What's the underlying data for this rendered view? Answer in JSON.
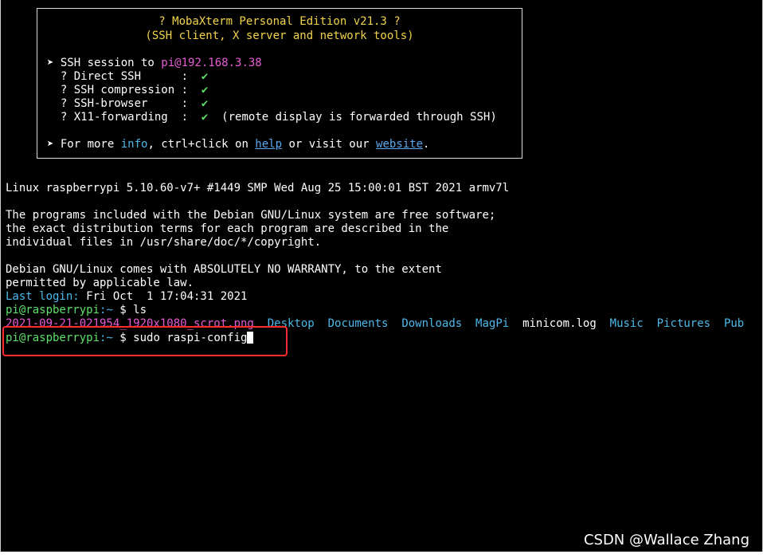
{
  "banner": {
    "title": "? MobaXterm Personal Edition v21.3 ?",
    "subtitle": "(SSH client, X server and network tools)",
    "session_prefix": "➤ SSH session to ",
    "session_target": "pi@192.168.3.38",
    "features": [
      {
        "label": "  ? Direct SSH      :  ",
        "check": "✔",
        "note": ""
      },
      {
        "label": "  ? SSH compression :  ",
        "check": "✔",
        "note": ""
      },
      {
        "label": "  ? SSH-browser     :  ",
        "check": "✔",
        "note": ""
      },
      {
        "label": "  ? X11-forwarding  :  ",
        "check": "✔",
        "note": "  (remote display is forwarded through SSH)"
      }
    ],
    "more_prefix": "➤ For more ",
    "more_info": "info",
    "more_mid": ", ctrl+click on ",
    "more_help": "help",
    "more_mid2": " or visit our ",
    "more_website": "website",
    "more_end": "."
  },
  "terminal": {
    "uname": "Linux raspberrypi 5.10.60-v7+ #1449 SMP Wed Aug 25 15:00:01 BST 2021 armv7l",
    "motd": [
      "The programs included with the Debian GNU/Linux system are free software;",
      "the exact distribution terms for each program are described in the",
      "individual files in /usr/share/doc/*/copyright."
    ],
    "warranty": [
      "Debian GNU/Linux comes with ABSOLUTELY NO WARRANTY, to the extent",
      "permitted by applicable law."
    ],
    "last_login_label": "Last login:",
    "last_login_value": " Fri Oct  1 17:04:31 2021",
    "prompt_user": "pi@raspberrypi",
    "prompt_sep": ":~",
    "prompt_dollar": " $ ",
    "cmd1": "ls",
    "ls_file1": "2021-09-21-021954_1920x1080_scrot.png",
    "ls_dirs": [
      "Desktop",
      "Documents",
      "Downloads",
      "MagPi"
    ],
    "ls_file2": "minicom.log",
    "ls_dirs2": [
      "Music",
      "Pictures",
      "Pub"
    ],
    "cmd2": "sudo raspi-config"
  },
  "watermark": "CSDN @Wallace Zhang"
}
